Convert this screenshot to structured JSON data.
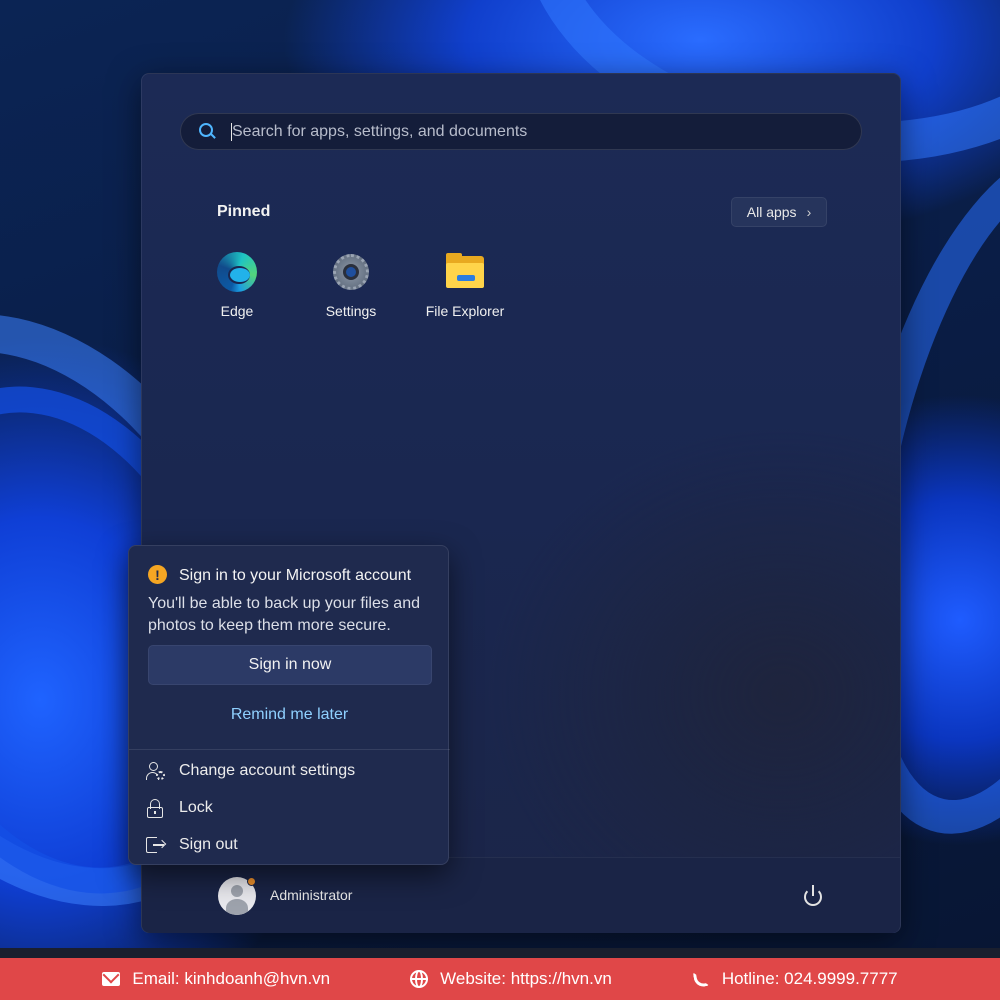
{
  "search": {
    "placeholder": "Search for apps, settings, and documents"
  },
  "pinned": {
    "title": "Pinned",
    "all_apps_label": "All apps",
    "apps": [
      {
        "label": "Edge",
        "icon": "edge-icon"
      },
      {
        "label": "Settings",
        "icon": "gear-icon"
      },
      {
        "label": "File Explorer",
        "icon": "folder-icon"
      }
    ]
  },
  "account_flyout": {
    "title": "Sign in to your Microsoft account",
    "description": "You'll be able to back up your files and photos to keep them more secure.",
    "primary_button": "Sign in now",
    "secondary_link": "Remind me later",
    "menu": [
      {
        "label": "Change account settings",
        "icon": "account-settings-icon"
      },
      {
        "label": "Lock",
        "icon": "lock-icon"
      },
      {
        "label": "Sign out",
        "icon": "sign-out-icon"
      }
    ]
  },
  "footer": {
    "username": "Administrator"
  },
  "banner": {
    "email": "Email: kinhdoanh@hvn.vn",
    "website": "Website: https://hvn.vn",
    "hotline": "Hotline: 024.9999.7777"
  },
  "colors": {
    "accent": "#4fb6ff",
    "warning": "#f5a623",
    "banner": "#e04748",
    "link": "#8fd0ff"
  }
}
